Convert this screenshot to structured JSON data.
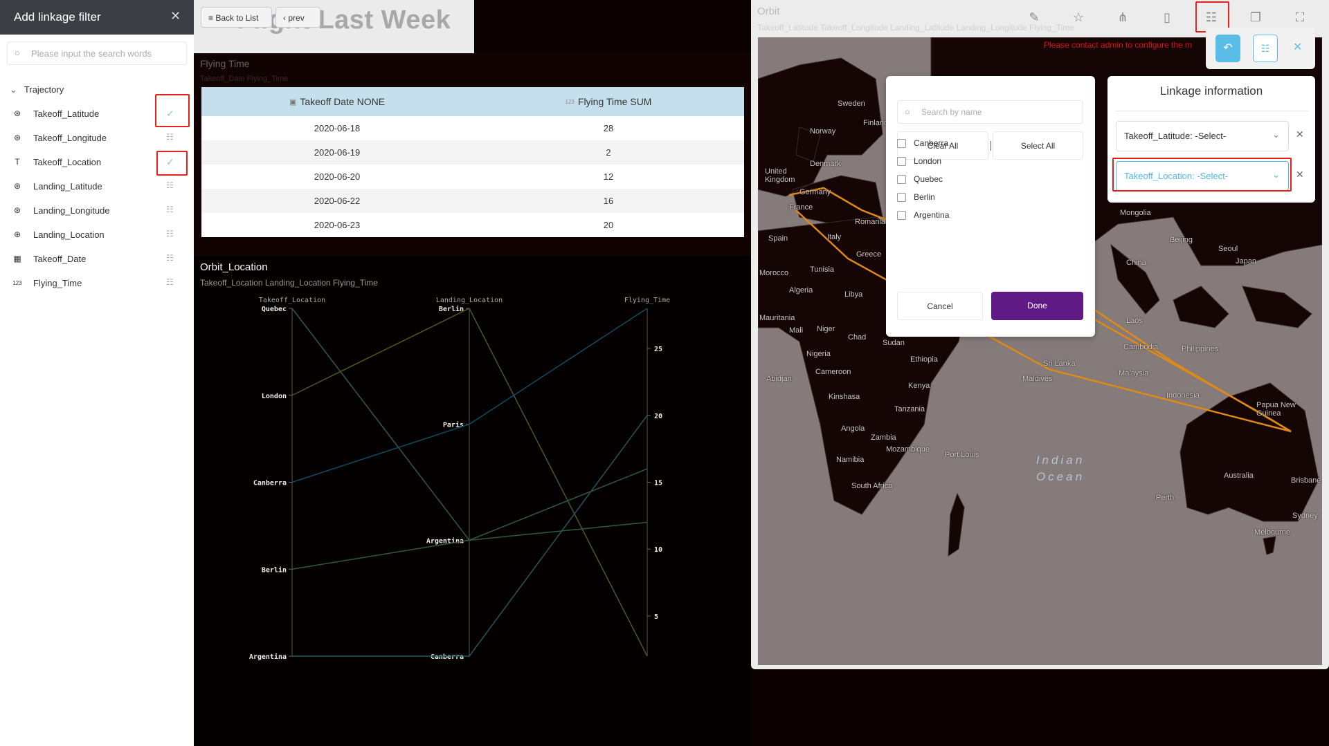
{
  "left_panel": {
    "title": "Add linkage filter",
    "close_icon": "close-icon",
    "search_placeholder": "Please input the search words",
    "group": "Trajectory",
    "items": [
      {
        "label": "Takeoff_Latitude",
        "icon": "geo-icon",
        "state": "checked"
      },
      {
        "label": "Takeoff_Longitude",
        "icon": "geo-icon",
        "state": "filter"
      },
      {
        "label": "Takeoff_Location",
        "icon": "text-icon",
        "state": "checked"
      },
      {
        "label": "Landing_Latitude",
        "icon": "geo-icon",
        "state": "filter"
      },
      {
        "label": "Landing_Longitude",
        "icon": "geo-icon",
        "state": "filter"
      },
      {
        "label": "Landing_Location",
        "icon": "globe-icon",
        "state": "filter"
      },
      {
        "label": "Takeoff_Date",
        "icon": "calendar-icon",
        "state": "filter"
      },
      {
        "label": "Flying_Time",
        "icon": "number-icon",
        "state": "filter"
      }
    ]
  },
  "header": {
    "back_label": "Back to List",
    "prev_label": "prev",
    "title": "Flight Last Week"
  },
  "flying_time_card": {
    "title": "Flying Time",
    "subtitle": "Takeoff_Date Flying_Time",
    "columns": [
      "Takeoff Date NONE",
      "Flying Time SUM"
    ],
    "rows": [
      [
        "2020-06-18",
        "28"
      ],
      [
        "2020-06-19",
        "2"
      ],
      [
        "2020-06-20",
        "12"
      ],
      [
        "2020-06-22",
        "16"
      ],
      [
        "2020-06-23",
        "20"
      ]
    ]
  },
  "chart_data": {
    "type": "parallel",
    "title": "Orbit_Location",
    "subtitle": "Takeoff_Location Landing_Location Flying_Time",
    "axes": [
      {
        "name": "Takeoff_Location",
        "categories": [
          "Quebec",
          "London",
          "Canberra",
          "Berlin",
          "Argentina"
        ]
      },
      {
        "name": "Landing_Location",
        "categories": [
          "Berlin",
          "Paris",
          "Argentina",
          "Canberra"
        ]
      },
      {
        "name": "Flying_Time",
        "range": [
          2,
          28
        ],
        "ticks": [
          5,
          10,
          15,
          20,
          25
        ]
      }
    ],
    "records": [
      {
        "values": [
          "London",
          "Berlin",
          2
        ],
        "color": "#4a5a24"
      },
      {
        "values": [
          "Quebec",
          "Argentina",
          16
        ],
        "color": "#2f5a4c"
      },
      {
        "values": [
          "Canberra",
          "Paris",
          28
        ],
        "color": "#0f4d63"
      },
      {
        "values": [
          "Berlin",
          "Argentina",
          12
        ],
        "color": "#35583f"
      },
      {
        "values": [
          "Argentina",
          "Canberra",
          20
        ],
        "color": "#245761"
      }
    ]
  },
  "orbit_panel": {
    "title": "Orbit",
    "subtitle": "Takeoff_Latitude Takeoff_Longitude Landing_Latitude Landing_Longitude Flying_Time",
    "toolbar": [
      "edit-icon",
      "star-icon",
      "share-icon",
      "pdf-icon",
      "linkage-filter-icon",
      "copy-icon",
      "fullscreen-icon"
    ],
    "warning": "Please contact admin to configure the m",
    "map_labels": [
      "Sweden",
      "Finland",
      "Norway",
      "Denmark",
      "United Kingdom",
      "Germany",
      "France",
      "Romania",
      "Italy",
      "Spain",
      "Greece",
      "Morocco",
      "Tunisia",
      "Algeria",
      "Libya",
      "Mauritania",
      "Mali",
      "Niger",
      "Chad",
      "Sudan",
      "Nigeria",
      "Ethiopia",
      "Cameroon",
      "Abidjan",
      "Kenya",
      "Kinshasa",
      "Tanzania",
      "Angola",
      "Zambia",
      "Mozambique",
      "Namibia",
      "South Africa",
      "Port Louis",
      "Maldives",
      "Sri Lanka",
      "Mongolia",
      "Beijing",
      "Seoul",
      "Japan",
      "China",
      "Laos",
      "Cambodia",
      "Philippines",
      "Malaysia",
      "Indonesia",
      "Papua New Guinea",
      "Australia",
      "Perth",
      "Brisbane",
      "Sydney",
      "Melbourne",
      "Indian Ocean"
    ]
  },
  "filter_popup": {
    "search_placeholder": "Search by name",
    "clear_all": "Clear All",
    "select_all": "Select All",
    "options": [
      "Canberra",
      "London",
      "Quebec",
      "Berlin",
      "Argentina"
    ],
    "cancel": "Cancel",
    "done": "Done",
    "done_color": "#5f1a85"
  },
  "linkage_info": {
    "title": "Linkage information",
    "selects": [
      {
        "value": "Takeoff_Latitude: -Select-",
        "active": false
      },
      {
        "value": "Takeoff_Location: -Select-",
        "active": true
      }
    ],
    "active_color": "#4fb8e8"
  }
}
